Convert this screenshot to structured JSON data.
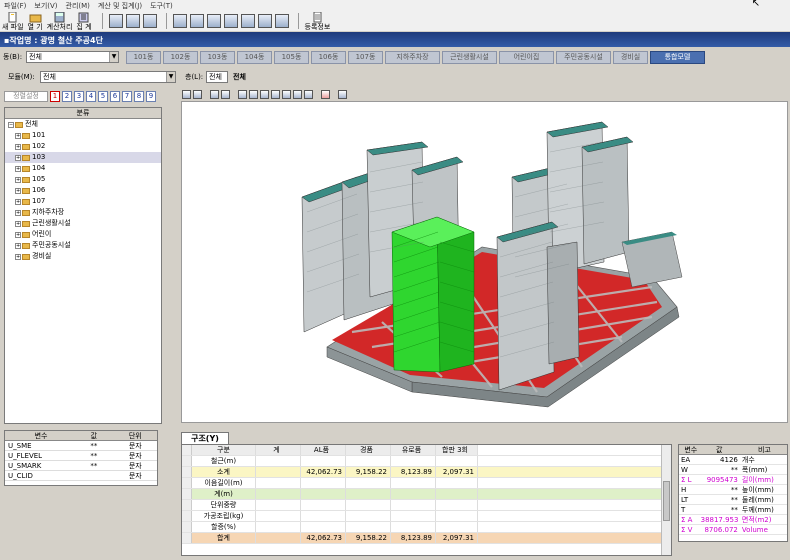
{
  "menu": [
    "파일(F)",
    "보기(V)",
    "관리(M)",
    "계산 및 집계(J)",
    "도구(T)"
  ],
  "toolbar": {
    "new_file": "새 파일",
    "open": "열   기",
    "calculate": "계산처리",
    "aggregate": "집   계",
    "register_info": "등록정보"
  },
  "work_title": "▪작업명 : 광명 철산 주공4단",
  "building_label": "동(B):",
  "building_value": "전체",
  "tabs": [
    "101동",
    "102동",
    "103동",
    "104동",
    "105동",
    "106동",
    "107동",
    "지하주차장",
    "근린생활시설",
    "어린이집",
    "주민공동시설",
    "경비실",
    "통합모델"
  ],
  "active_tab": "통합모델",
  "module_label": "모듈(M):",
  "module_value": "전체",
  "floor_label": "층(L):",
  "floor_value": "전체",
  "floor_text": "전체",
  "left_toolbar": {
    "settings_button": "정렬설정",
    "numbers": [
      "1",
      "2",
      "3",
      "4",
      "5",
      "6",
      "7",
      "8",
      "9"
    ]
  },
  "tree": {
    "header": "분류",
    "root": "전체",
    "items": [
      "101",
      "102",
      "103",
      "104",
      "105",
      "106",
      "107",
      "지하주차장",
      "근린생활시설",
      "어린이",
      "주민공동시설",
      "경비실"
    ],
    "selected": "103"
  },
  "var_table": {
    "headers": [
      "변수",
      "값",
      "단위"
    ],
    "rows": [
      [
        "U_SME",
        "**",
        "문자"
      ],
      [
        "U_FLEVEL",
        "**",
        "문자"
      ],
      [
        "U_SMARK",
        "**",
        "문자"
      ],
      [
        "U_CLID",
        "",
        "문자"
      ]
    ]
  },
  "bottom_tab": "구조(Y)",
  "summary_table": {
    "headers": [
      "구분",
      "계",
      "AL품",
      "경품",
      "유로품",
      "합판 3회"
    ],
    "rows": [
      {
        "label": "철근(m)",
        "values": [
          "",
          "",
          "",
          "",
          ""
        ],
        "style": ""
      },
      {
        "label": "소계",
        "values": [
          "",
          "42,062.73",
          "9,158.22",
          "8,123.89",
          "2,097.31"
        ],
        "style": "yellow"
      },
      {
        "label": "이음길이(m)",
        "values": [
          "",
          "",
          "",
          "",
          ""
        ],
        "style": ""
      },
      {
        "label": "계(m)",
        "values": [
          "",
          "",
          "",
          "",
          ""
        ],
        "style": "green"
      },
      {
        "label": "단위중량",
        "values": [
          "",
          "",
          "",
          "",
          ""
        ],
        "style": ""
      },
      {
        "label": "가공조립(kg)",
        "values": [
          "",
          "",
          "",
          "",
          ""
        ],
        "style": ""
      },
      {
        "label": "할증(%)",
        "values": [
          "",
          "",
          "",
          "",
          ""
        ],
        "style": ""
      },
      {
        "label": "합계",
        "values": [
          "",
          "42,062.73",
          "9,158.22",
          "8,123.89",
          "2,097.31"
        ],
        "style": "peach"
      }
    ]
  },
  "param_table": {
    "headers": [
      "변수",
      "값",
      "비고"
    ],
    "rows": [
      {
        "var": "EA",
        "val": "4126",
        "note": "개수",
        "mag": false
      },
      {
        "var": "W",
        "val": "**",
        "note": "폭(mm)",
        "mag": false
      },
      {
        "var": "Σ L",
        "val": "9095473",
        "note": "길이(mm)",
        "mag": true
      },
      {
        "var": "H",
        "val": "**",
        "note": "높이(mm)",
        "mag": false
      },
      {
        "var": "LT",
        "val": "**",
        "note": "둘레(mm)",
        "mag": false
      },
      {
        "var": "T",
        "val": "**",
        "note": "두께(mm)",
        "mag": false
      },
      {
        "var": "Σ A",
        "val": "38817.953",
        "note": "면적(m2)",
        "mag": true
      },
      {
        "var": "Σ V",
        "val": "8706.072",
        "note": "Volume",
        "mag": true
      }
    ]
  },
  "colors": {
    "active_tab": "#4a6fb0",
    "title_bar": "#1e3a7c",
    "highlight_building": "#22dd22",
    "building_roof": "#3a8c84",
    "parking_floor": "#e02020"
  }
}
